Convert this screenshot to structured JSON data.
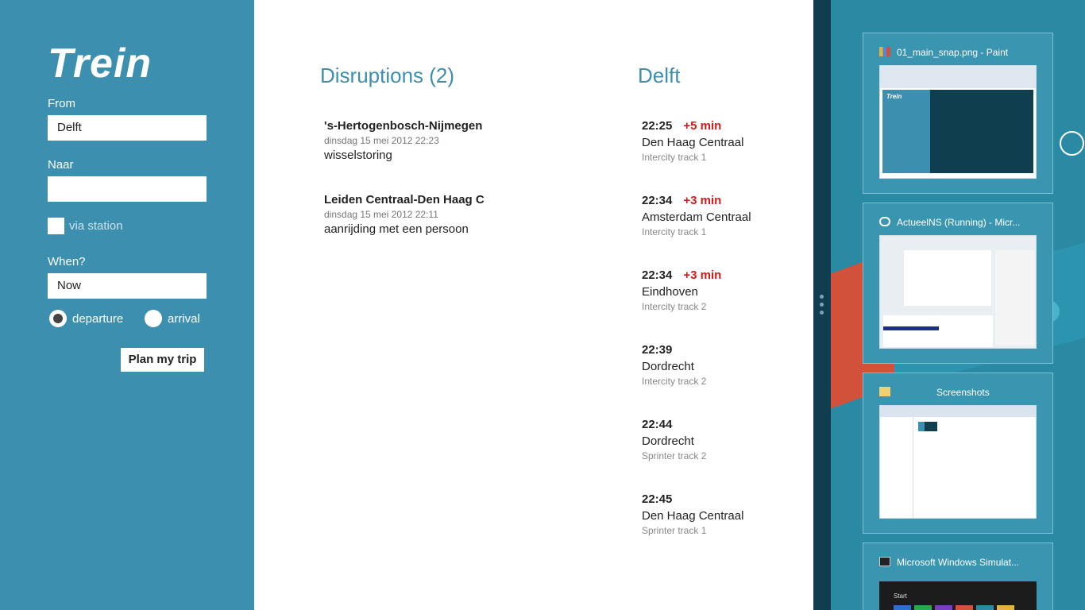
{
  "app": {
    "title": "Trein"
  },
  "form": {
    "from_label": "From",
    "from_value": "Delft",
    "to_label": "Naar",
    "to_value": "",
    "via_label": "via station",
    "when_label": "When?",
    "when_value": "Now",
    "departure_label": "departure",
    "arrival_label": "arrival",
    "selected_mode": "departure",
    "plan_button": "Plan my trip"
  },
  "disruptions": {
    "title": "Disruptions (2)",
    "items": [
      {
        "route": "'s-Hertogenbosch-Nijmegen",
        "date": "dinsdag 15 mei 2012 22:23",
        "description": "wisselstoring"
      },
      {
        "route": "Leiden Centraal-Den Haag C",
        "date": "dinsdag 15 mei 2012 22:11",
        "description": "aanrijding met een persoon"
      }
    ]
  },
  "departures": {
    "station": "Delft",
    "items": [
      {
        "time": "22:25",
        "delay": "+5 min",
        "destination": "Den Haag Centraal",
        "track": "Intercity track 1"
      },
      {
        "time": "22:34",
        "delay": "+3 min",
        "destination": "Amsterdam Centraal",
        "track": "Intercity track 1"
      },
      {
        "time": "22:34",
        "delay": "+3 min",
        "destination": "Eindhoven",
        "track": "Intercity track 2"
      },
      {
        "time": "22:39",
        "delay": "",
        "destination": "Dordrecht",
        "track": "Intercity track 2"
      },
      {
        "time": "22:44",
        "delay": "",
        "destination": "Dordrecht",
        "track": "Sprinter track 2"
      },
      {
        "time": "22:45",
        "delay": "",
        "destination": "Den Haag Centraal",
        "track": "Sprinter track 1"
      }
    ]
  },
  "switcher": {
    "windows": [
      {
        "title": "01_main_snap.png - Paint",
        "icon": "paint-icon",
        "preview_text": "Trein"
      },
      {
        "title": "ActueelNS (Running) - Micr...",
        "icon": "visual-studio-icon"
      },
      {
        "title": "Screenshots",
        "icon": "folder-icon"
      },
      {
        "title": "Microsoft Windows Simulat...",
        "icon": "simulator-icon",
        "preview_text": "Start"
      }
    ]
  },
  "colors": {
    "accent": "#3c8fae",
    "delay": "#d41a1a",
    "divider": "#103e50",
    "switcher_bg": "#2a8aa3"
  }
}
